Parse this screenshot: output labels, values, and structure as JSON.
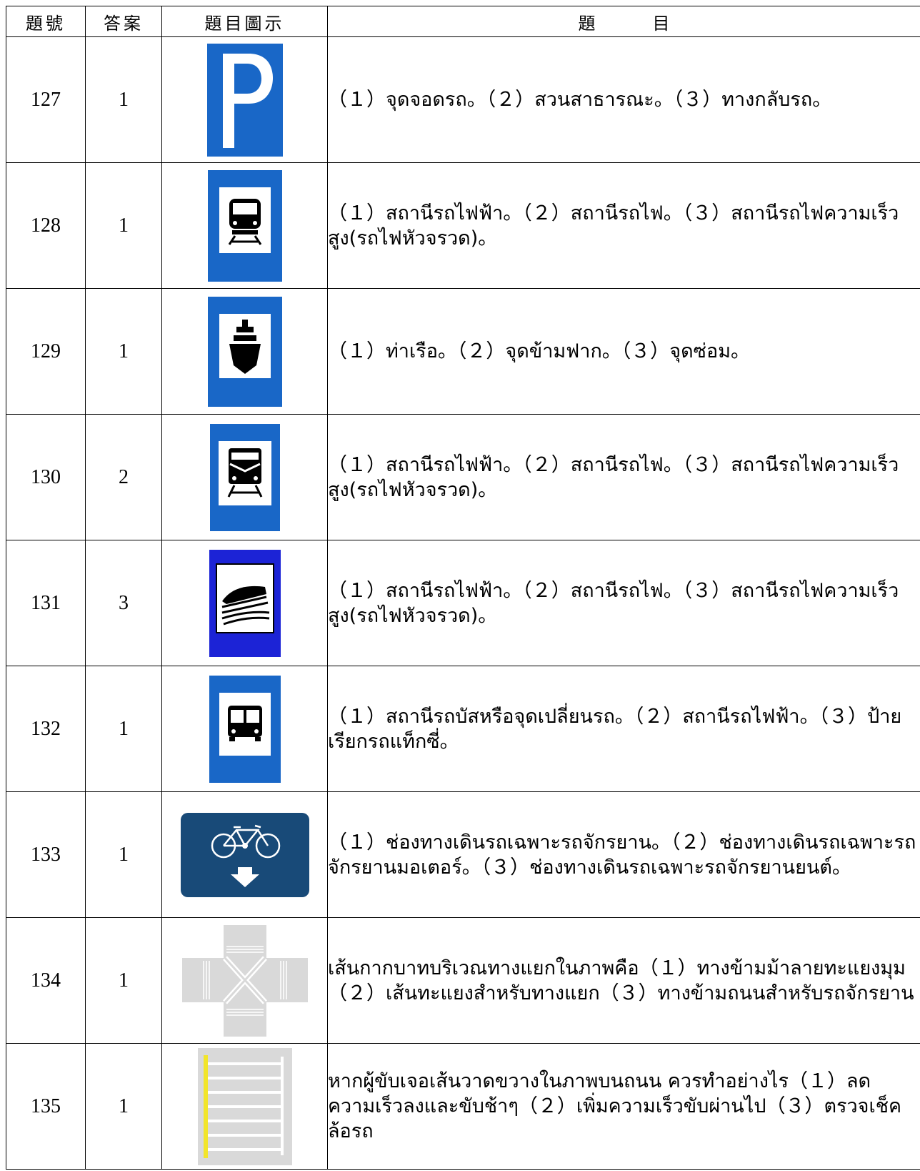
{
  "header": {
    "no": "題號",
    "answer": "答案",
    "image": "題目圖示",
    "topic_a": "題",
    "topic_b": "目"
  },
  "rows": [
    {
      "no": "127",
      "answer": "1",
      "icon": "parking-sign-icon",
      "text": "（１）จุดจอดรถ。（２）สวนสาธารณะ。（３）ทางกลับรถ。"
    },
    {
      "no": "128",
      "answer": "1",
      "icon": "metro-station-sign-icon",
      "text": "（１）สถานีรถไฟฟ้า。（２）สถานีรถไฟ。（３）สถานีรถไฟความเร็วสูง(รถไฟหัวจรวด)。"
    },
    {
      "no": "129",
      "answer": "1",
      "icon": "ship-port-sign-icon",
      "text": "（１）ท่าเรือ。（２）จุดข้ามฟาก。（３）จุดซ่อม。"
    },
    {
      "no": "130",
      "answer": "2",
      "icon": "train-station-sign-icon",
      "text": "（１）สถานีรถไฟฟ้า。（２）สถานีรถไฟ。（３）สถานีรถไฟความเร็วสูง(รถไฟหัวจรวด)。"
    },
    {
      "no": "131",
      "answer": "3",
      "icon": "high-speed-rail-sign-icon",
      "text": "（１）สถานีรถไฟฟ้า。（２）สถานีรถไฟ。（３）สถานีรถไฟความเร็วสูง(รถไฟหัวจรวด)。"
    },
    {
      "no": "132",
      "answer": "1",
      "icon": "bus-station-sign-icon",
      "text": "（１）สถานีรถบัสหรือจุดเปลี่ยนรถ。（２）สถานีรถไฟฟ้า。（３）ป้ายเรียกรถแท็กซี่。"
    },
    {
      "no": "133",
      "answer": "1",
      "icon": "bicycle-lane-sign-icon",
      "text": "（１）ช่องทางเดินรถเฉพาะรถจักรยาน。（２）ช่องทางเดินรถเฉพาะรถจักรยานมอเตอร์。（３）ช่องทางเดินรถเฉพาะรถจักรยานยนต์。"
    },
    {
      "no": "134",
      "answer": "1",
      "icon": "diagonal-crosswalk-icon",
      "text": "เส้นกากบาทบริเวณทางแยกในภาพคือ（１）ทางข้ามม้าลายทะแยงมุม（２）เส้นทะแยงสำหรับทางแยก（３）ทางข้ามถนนสำหรับรถจักรยาน"
    },
    {
      "no": "135",
      "answer": "1",
      "icon": "transverse-road-lines-icon",
      "text": "หากผู้ขับเจอเส้นวาดขวางในภาพบนถนน ควรทำอย่างไร（１）ลดความเร็วลงและขับช้าๆ（２）เพิ่มความเร็วขับผ่านไป（３）ตรวจเช็คล้อรถ"
    }
  ],
  "colors": {
    "sign_blue": "#1967c7",
    "sign_dark_blue": "#184a78",
    "road_gray": "#d9d9d9",
    "line_yellow": "#f2e52a"
  }
}
